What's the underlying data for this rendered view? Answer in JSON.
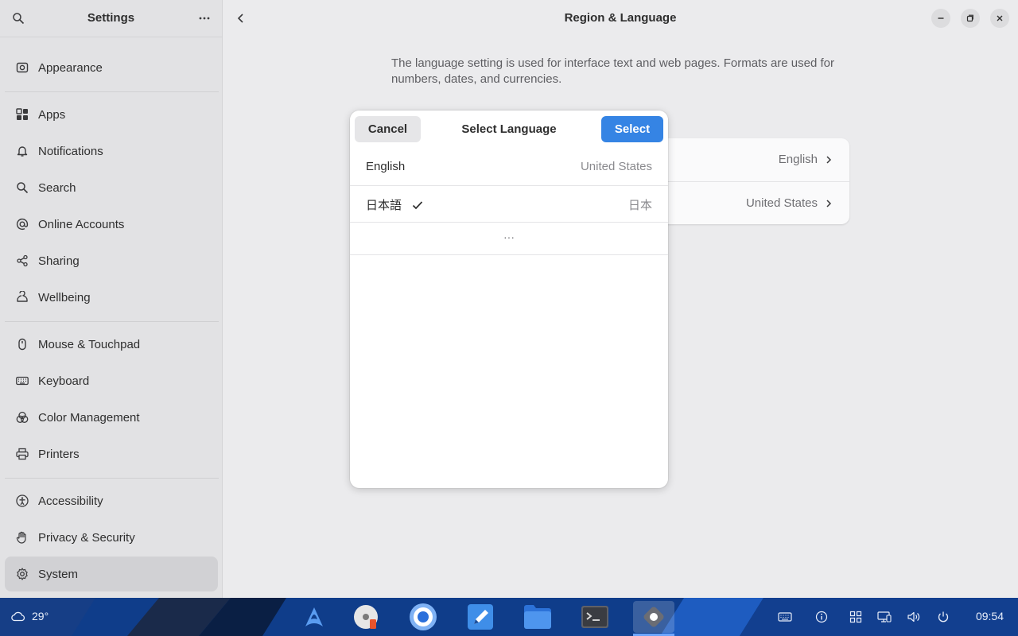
{
  "sidebar": {
    "title": "Settings",
    "items": [
      {
        "label": "Appearance",
        "icon": "appearance-icon"
      },
      {
        "label": "Apps",
        "icon": "apps-icon"
      },
      {
        "label": "Notifications",
        "icon": "bell-icon"
      },
      {
        "label": "Search",
        "icon": "search-icon"
      },
      {
        "label": "Online Accounts",
        "icon": "at-icon"
      },
      {
        "label": "Sharing",
        "icon": "share-icon"
      },
      {
        "label": "Wellbeing",
        "icon": "wellbeing-icon"
      },
      {
        "label": "Mouse & Touchpad",
        "icon": "mouse-icon"
      },
      {
        "label": "Keyboard",
        "icon": "keyboard-icon"
      },
      {
        "label": "Color Management",
        "icon": "color-icon"
      },
      {
        "label": "Printers",
        "icon": "printer-icon"
      },
      {
        "label": "Accessibility",
        "icon": "accessibility-icon"
      },
      {
        "label": "Privacy & Security",
        "icon": "hand-icon"
      },
      {
        "label": "System",
        "icon": "gear-icon",
        "selected": true
      }
    ]
  },
  "main": {
    "title": "Region & Language",
    "description": "The language setting is used for interface text and web pages. Formats are used for numbers, dates, and currencies.",
    "card_rows": [
      {
        "value": "English"
      },
      {
        "value": "United States"
      }
    ]
  },
  "dialog": {
    "title": "Select Language",
    "cancel_label": "Cancel",
    "select_label": "Select",
    "languages": [
      {
        "name": "English",
        "region": "United States",
        "checked": false
      },
      {
        "name": "日本語",
        "region": "日本",
        "checked": true
      }
    ],
    "more_label": "···"
  },
  "taskbar": {
    "weather_temp": "29°",
    "clock": "09:54",
    "dock_apps": [
      "arch-launcher-icon",
      "disk-utility-icon",
      "browser-icon",
      "text-editor-icon",
      "files-icon",
      "terminal-icon",
      "settings-app-icon"
    ],
    "tray": [
      "keyboard-layout-icon",
      "info-icon",
      "workspaces-icon",
      "display-icon",
      "volume-icon",
      "power-icon"
    ]
  },
  "colors": {
    "accent": "#3584e4",
    "taskbar": "#0f3d8a"
  }
}
